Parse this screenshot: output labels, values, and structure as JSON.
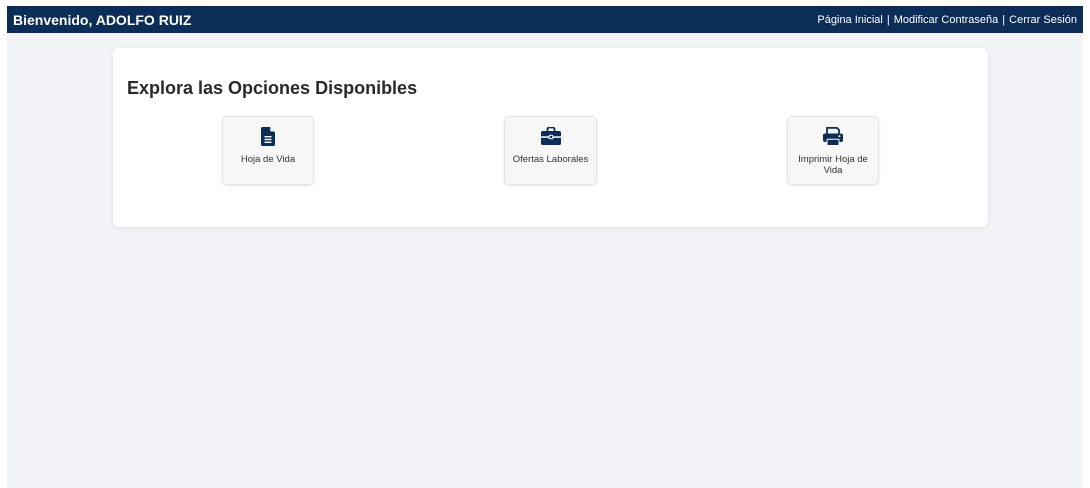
{
  "header": {
    "welcome": "Bienvenido, ADOLFO RUIZ",
    "nav": [
      {
        "label": "Página Inicial"
      },
      {
        "label": "Modificar Contraseña"
      },
      {
        "label": "Cerrar Sesión"
      }
    ],
    "separator": "|"
  },
  "main": {
    "title": "Explora las Opciones Disponibles",
    "options": [
      {
        "label": "Hoja de Vida",
        "icon": "file-document-icon"
      },
      {
        "label": "Ofertas Laborales",
        "icon": "briefcase-icon"
      },
      {
        "label": "Imprimir Hoja de Vida",
        "icon": "printer-icon"
      }
    ]
  },
  "colors": {
    "header_bg": "#0b2d57",
    "icon": "#0b2d57",
    "page_bg": "#f3f4f8"
  }
}
